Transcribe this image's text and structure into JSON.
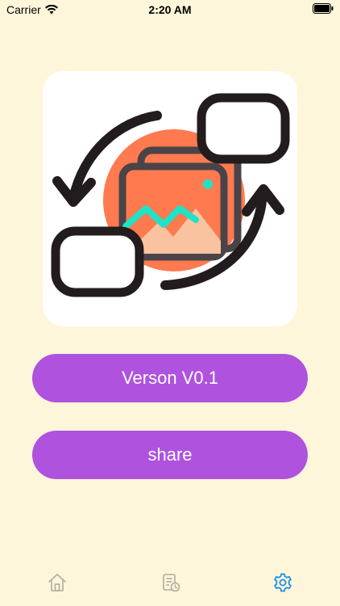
{
  "status_bar": {
    "carrier": "Carrier",
    "time": "2:20 AM"
  },
  "app_icon": {
    "icon_name": "image-convert-icon"
  },
  "buttons": {
    "version_label": "Verson V0.1",
    "share_label": "share"
  },
  "tab_bar": {
    "tabs": [
      {
        "icon": "home-icon",
        "active": false
      },
      {
        "icon": "history-icon",
        "active": false
      },
      {
        "icon": "settings-icon",
        "active": true
      }
    ],
    "active_color": "#1a8fe3",
    "inactive_color": "#b0aba0"
  },
  "colors": {
    "background": "#fdf6da",
    "button": "#af52de",
    "icon_circle": "#ff7a4f"
  }
}
